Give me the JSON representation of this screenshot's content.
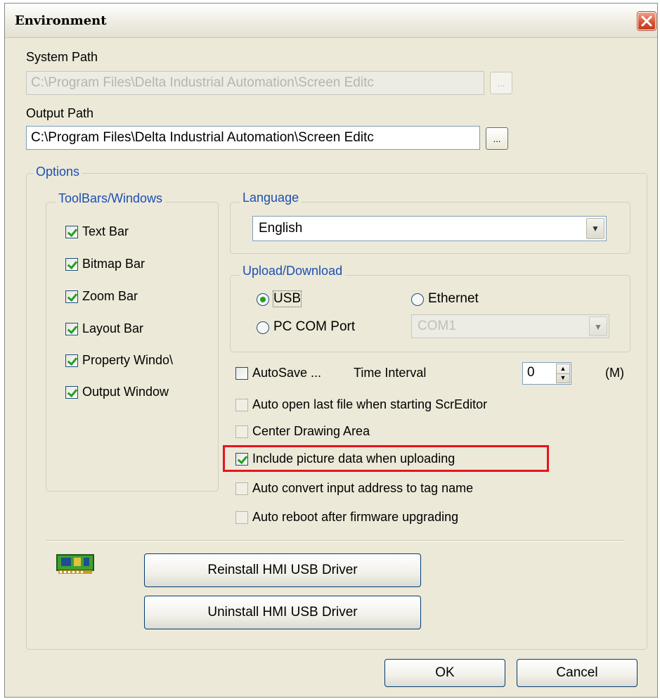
{
  "window": {
    "title": "Environment"
  },
  "system_path": {
    "label": "System Path",
    "value": "C:\\Program Files\\Delta Industrial Automation\\Screen Editc",
    "browse_label": "..."
  },
  "output_path": {
    "label": "Output Path",
    "value": "C:\\Program Files\\Delta Industrial Automation\\Screen Editc",
    "browse_label": "..."
  },
  "options": {
    "title": "Options",
    "toolbars": {
      "title": "ToolBars/Windows",
      "items": [
        {
          "label": "Text Bar",
          "checked": true
        },
        {
          "label": "Bitmap Bar",
          "checked": true
        },
        {
          "label": "Zoom Bar",
          "checked": true
        },
        {
          "label": "Layout Bar",
          "checked": true
        },
        {
          "label": "Property Windo\\",
          "checked": true
        },
        {
          "label": "Output Window",
          "checked": true
        }
      ]
    },
    "language": {
      "title": "Language",
      "selected": "English"
    },
    "upload_download": {
      "title": "Upload/Download",
      "usb_label": "USB",
      "ethernet_label": "Ethernet",
      "pc_com_label": "PC COM Port",
      "com_value": "COM1",
      "selected": "USB"
    },
    "autosave": {
      "label": "AutoSave ...",
      "interval_label": "Time Interval",
      "interval_value": "0",
      "unit": "(M)",
      "checked": false
    },
    "checkboxes": [
      {
        "label": "Auto open last file when starting ScrEditor",
        "checked": false
      },
      {
        "label": "Center Drawing Area",
        "checked": false
      },
      {
        "label": "Include picture data when uploading",
        "checked": true
      },
      {
        "label": "Auto convert input address to tag name",
        "checked": false
      },
      {
        "label": "Auto reboot after firmware upgrading",
        "checked": false
      }
    ],
    "driver": {
      "icon": "usb-board-icon",
      "reinstall_label": "Reinstall HMI USB Driver",
      "uninstall_label": "Uninstall HMI USB Driver"
    }
  },
  "footer": {
    "ok_label": "OK",
    "cancel_label": "Cancel"
  },
  "colors": {
    "highlight": "#e8131b",
    "group_title": "#1c4fb3",
    "check_mark": "#21a121",
    "dialog_bg": "#ece9d8"
  }
}
